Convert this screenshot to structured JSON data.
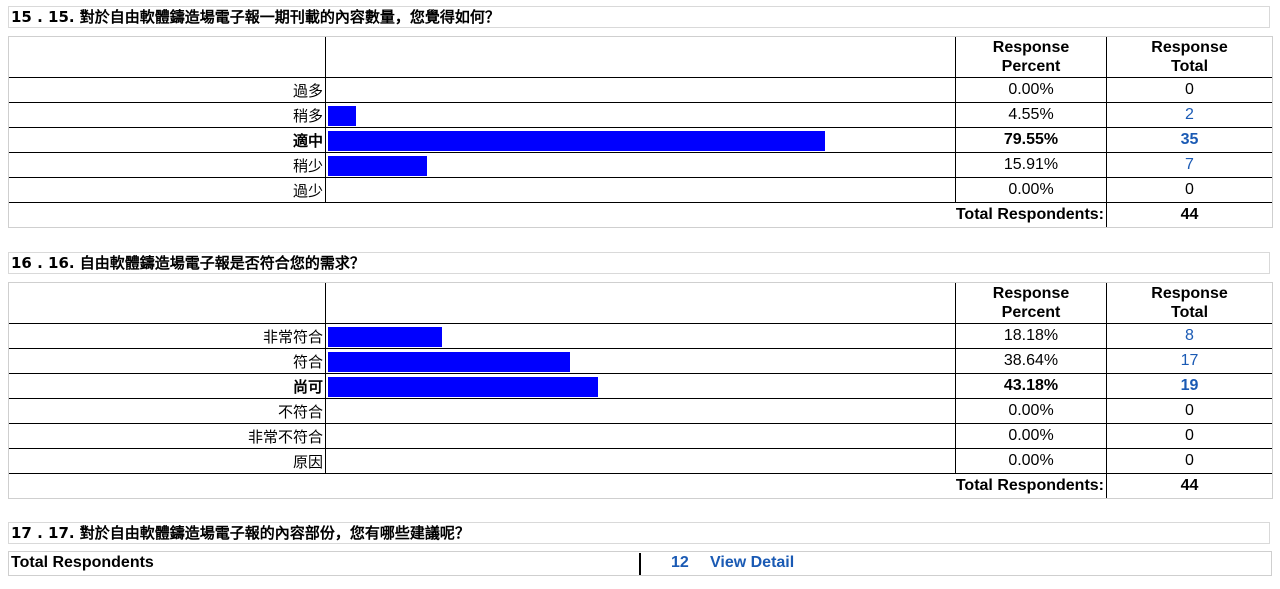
{
  "columns": {
    "percent_label": "Response Percent",
    "percent_line1": "Response",
    "percent_line2": "Percent",
    "total_line1": "Response",
    "total_line2": "Total"
  },
  "total_respondents_label": "Total Respondents:",
  "questions": [
    {
      "title": "15 . 15. 對於自由軟體鑄造場電子報一期刊載的內容數量，您覺得如何？",
      "rows": [
        {
          "label": "過多",
          "percent": "0.00%",
          "fraction": 0.0,
          "total": "0",
          "highlight": false
        },
        {
          "label": "稍多",
          "percent": "4.55%",
          "fraction": 0.0455,
          "total": "2",
          "highlight": false
        },
        {
          "label": "適中",
          "percent": "79.55%",
          "fraction": 0.7955,
          "total": "35",
          "highlight": true
        },
        {
          "label": "稍少",
          "percent": "15.91%",
          "fraction": 0.1591,
          "total": "7",
          "highlight": false
        },
        {
          "label": "過少",
          "percent": "0.00%",
          "fraction": 0.0,
          "total": "0",
          "highlight": false
        }
      ],
      "total_respondents": "44"
    },
    {
      "title": "16 . 16. 自由軟體鑄造場電子報是否符合您的需求？",
      "rows": [
        {
          "label": "非常符合",
          "percent": "18.18%",
          "fraction": 0.1818,
          "total": "8",
          "highlight": false
        },
        {
          "label": "符合",
          "percent": "38.64%",
          "fraction": 0.3864,
          "total": "17",
          "highlight": false
        },
        {
          "label": "尚可",
          "percent": "43.18%",
          "fraction": 0.4318,
          "total": "19",
          "highlight": true
        },
        {
          "label": "不符合",
          "percent": "0.00%",
          "fraction": 0.0,
          "total": "0",
          "highlight": false
        },
        {
          "label": "非常不符合",
          "percent": "0.00%",
          "fraction": 0.0,
          "total": "0",
          "highlight": false
        },
        {
          "label": "原因",
          "percent": "0.00%",
          "fraction": 0.0,
          "total": "0",
          "highlight": false
        }
      ],
      "total_respondents": "44"
    },
    {
      "title": "17 . 17. 對於自由軟體鑄造場電子報的內容部份，您有哪些建議呢？",
      "open_label": "Total Respondents",
      "open_count": "12",
      "view_detail": "View Detail"
    }
  ],
  "colors": {
    "bar": "#0000ff",
    "link": "#1a5ab4"
  }
}
